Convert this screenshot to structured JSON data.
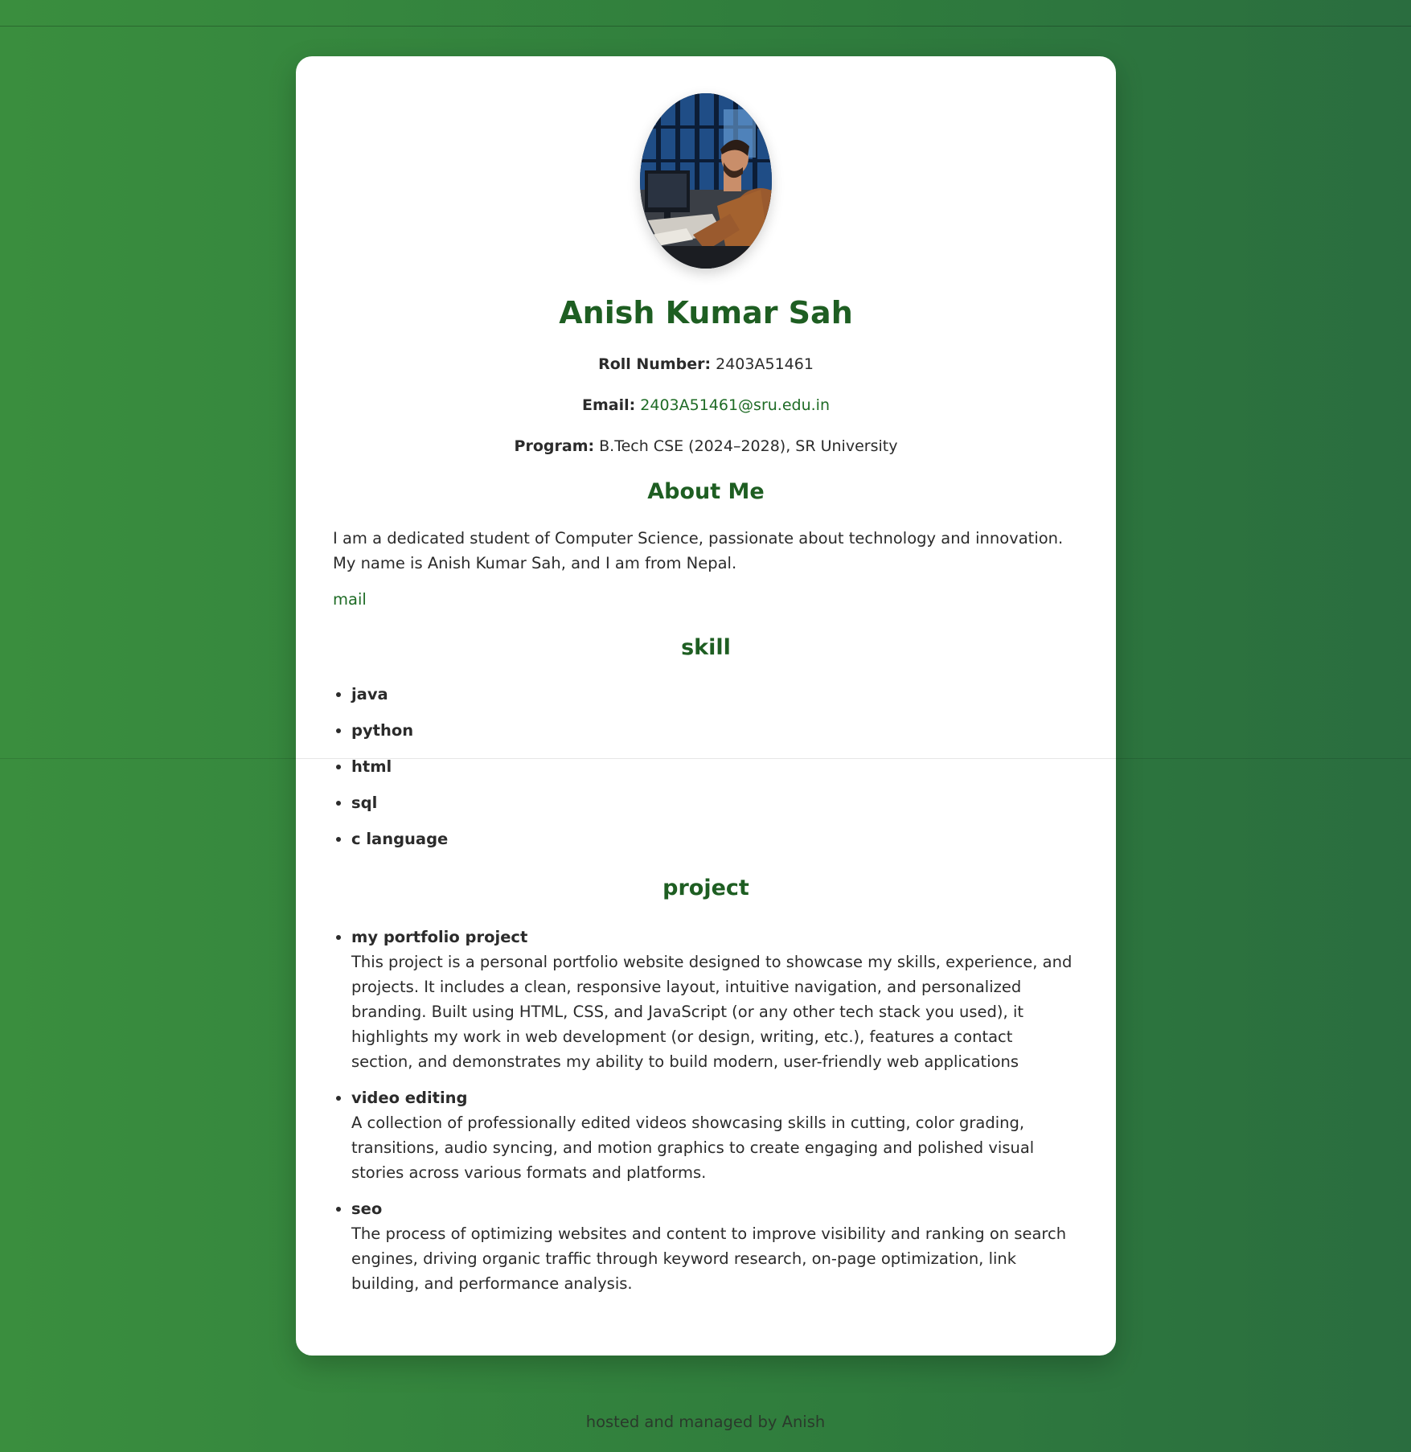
{
  "profile": {
    "name": "Anish Kumar Sah",
    "roll_label": "Roll Number:",
    "roll_value": "2403A51461",
    "email_label": "Email:",
    "email_value": "2403A51461@sru.edu.in",
    "program_label": "Program:",
    "program_value": "B.Tech CSE (2024–2028), SR University",
    "avatar_alt": "photo of a man working at a computer"
  },
  "about": {
    "title": "About Me",
    "text": "I am a dedicated student of Computer Science, passionate about technology and innovation. My name is Anish Kumar Sah, and I am from Nepal.",
    "mail_link": "mail"
  },
  "skills": {
    "title": "skill",
    "items": [
      "java",
      "python",
      "html",
      "sql",
      "c language"
    ]
  },
  "projects": {
    "title": "project",
    "items": [
      {
        "name": "my portfolio project",
        "description": "This project is a personal portfolio website designed to showcase my skills, experience, and projects. It includes a clean, responsive layout, intuitive navigation, and personalized branding. Built using HTML, CSS, and JavaScript (or any other tech stack you used), it highlights my work in web development (or design, writing, etc.), features a contact section, and demonstrates my ability to build modern, user-friendly web applications"
      },
      {
        "name": "video editing",
        "description": "A collection of professionally edited videos showcasing skills in cutting, color grading, transitions, audio syncing, and motion graphics to create engaging and polished visual stories across various formats and platforms."
      },
      {
        "name": "seo",
        "description": "The process of optimizing websites and content to improve visibility and ranking on search engines, driving organic traffic through keyword research, on-page optimization, link building, and performance analysis."
      }
    ]
  },
  "footer": {
    "text": "hosted and managed by Anish"
  },
  "colors": {
    "accent": "#1e5e22",
    "link": "#1e6b25",
    "background_start": "#3a8e3e",
    "background_end": "#2a6d3f"
  }
}
